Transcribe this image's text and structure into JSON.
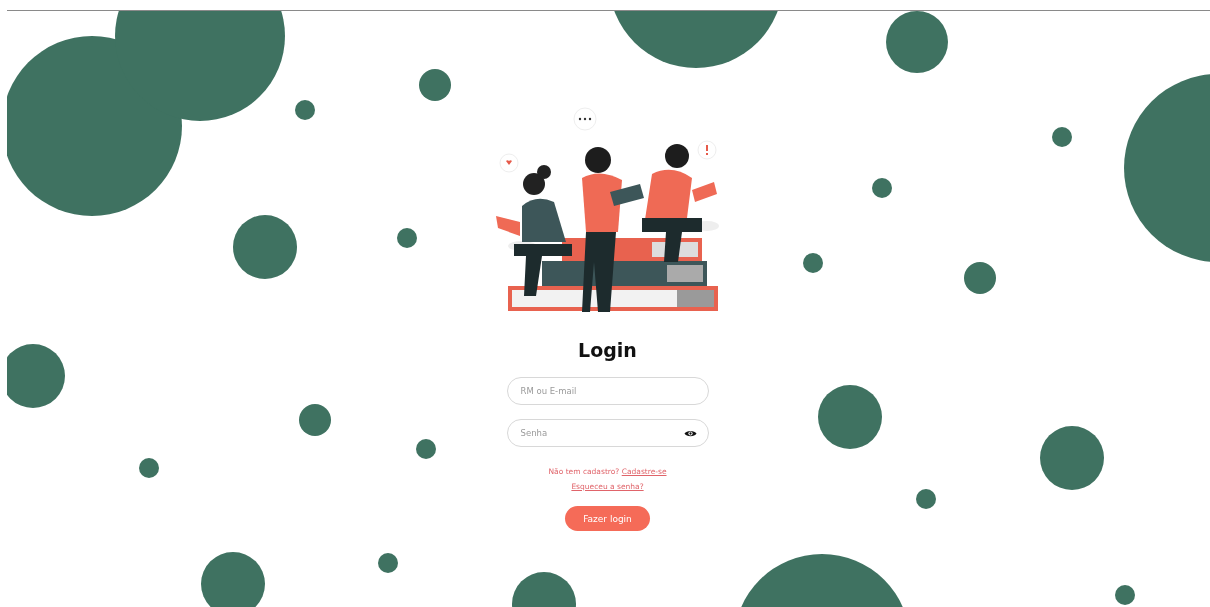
{
  "form": {
    "title": "Login",
    "fields": [
      {
        "kind": "text",
        "placeholder": "RM ou E-mail"
      },
      {
        "kind": "password",
        "placeholder": "Senha"
      }
    ],
    "signup_prompt": "Não tem cadastro?",
    "signup_link": "Cadastre-se",
    "forgot_link": "Esqueceu a senha?",
    "submit": "Fazer login"
  }
}
